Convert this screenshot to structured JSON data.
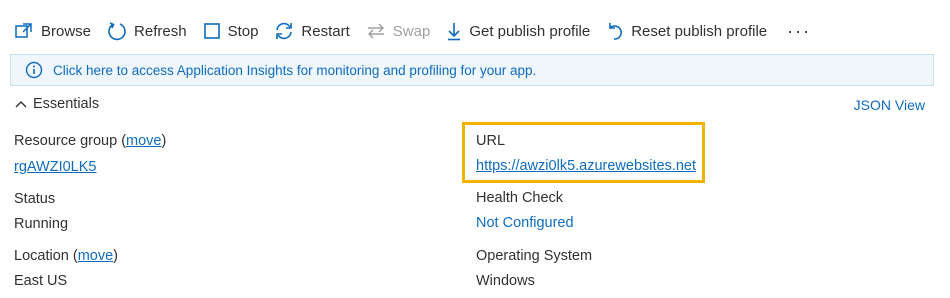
{
  "toolbar": {
    "browse": "Browse",
    "refresh": "Refresh",
    "stop": "Stop",
    "restart": "Restart",
    "swap": "Swap",
    "get_publish_profile": "Get publish profile",
    "reset_publish_profile": "Reset publish profile",
    "more": "···"
  },
  "info_bar": {
    "text": "Click here to access Application Insights for monitoring and profiling for your app."
  },
  "essentials": {
    "title": "Essentials",
    "json_view": "JSON View"
  },
  "left": {
    "resource_group_label": "Resource group (",
    "resource_group_move": "move",
    "resource_group_close": ")",
    "resource_group_value": "rgAWZI0LK5",
    "status_label": "Status",
    "status_value": "Running",
    "location_label": "Location (",
    "location_move": "move",
    "location_close": ")",
    "location_value": "East US"
  },
  "right": {
    "url_label": "URL",
    "url_value": "https://awzi0lk5.azurewebsites.net",
    "health_label": "Health Check",
    "health_value": "Not Configured",
    "os_label": "Operating System",
    "os_value": "Windows"
  },
  "colors": {
    "link": "#0f6cbd",
    "highlight": "#f0b400",
    "info_bg": "#eff6fc",
    "text": "#323130"
  }
}
